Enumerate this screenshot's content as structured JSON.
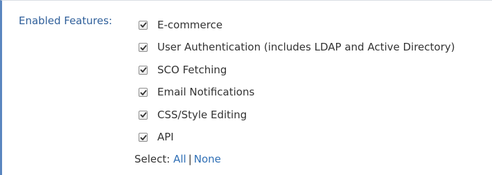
{
  "field": {
    "label": "Enabled Features:"
  },
  "features": [
    {
      "label": "E-commerce",
      "checked": true
    },
    {
      "label": "User Authentication (includes LDAP and Active Directory)",
      "checked": true
    },
    {
      "label": "SCO Fetching",
      "checked": true
    },
    {
      "label": "Email Notifications",
      "checked": true
    },
    {
      "label": "CSS/Style Editing",
      "checked": true
    },
    {
      "label": "API",
      "checked": true
    }
  ],
  "select": {
    "prefix": "Select:",
    "all_label": "All",
    "separator": "|",
    "none_label": "None"
  },
  "colors": {
    "accent_border": "#5a86bf",
    "label_text": "#2f5f9a",
    "link": "#2f6fb5"
  }
}
